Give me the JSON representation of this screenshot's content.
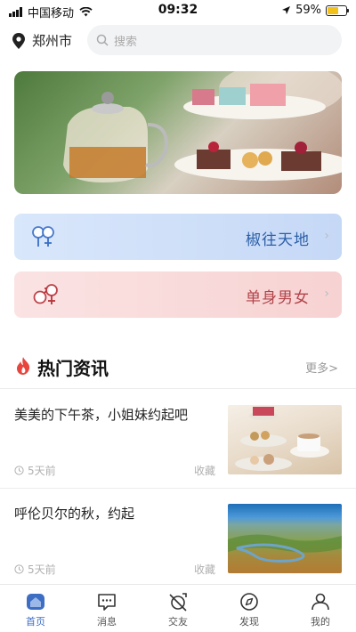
{
  "status_bar": {
    "carrier": "中国移动",
    "time": "09:32",
    "battery": "59%",
    "battery_level": 0.59
  },
  "location": {
    "city": "郑州市"
  },
  "search": {
    "placeholder": "搜索"
  },
  "cards": [
    {
      "label": "椒往天地",
      "color": "#2c5fa8"
    },
    {
      "label": "单身男女",
      "color": "#b2444a"
    }
  ],
  "section": {
    "title": "热门资讯",
    "more": "更多>"
  },
  "news": [
    {
      "title": "美美的下午茶，小姐妹约起吧",
      "time": "5天前",
      "fav": "收藏"
    },
    {
      "title": "呼伦贝尔的秋，约起",
      "time": "5天前",
      "fav": "收藏"
    }
  ],
  "tabs": [
    {
      "label": "首页",
      "icon": "home-icon",
      "active": true
    },
    {
      "label": "消息",
      "icon": "message-icon"
    },
    {
      "label": "交友",
      "icon": "friends-icon"
    },
    {
      "label": "发现",
      "icon": "compass-icon"
    },
    {
      "label": "我的",
      "icon": "profile-icon"
    }
  ],
  "colors": {
    "accent": "#3d6ec4",
    "fire": "#e8453c"
  }
}
